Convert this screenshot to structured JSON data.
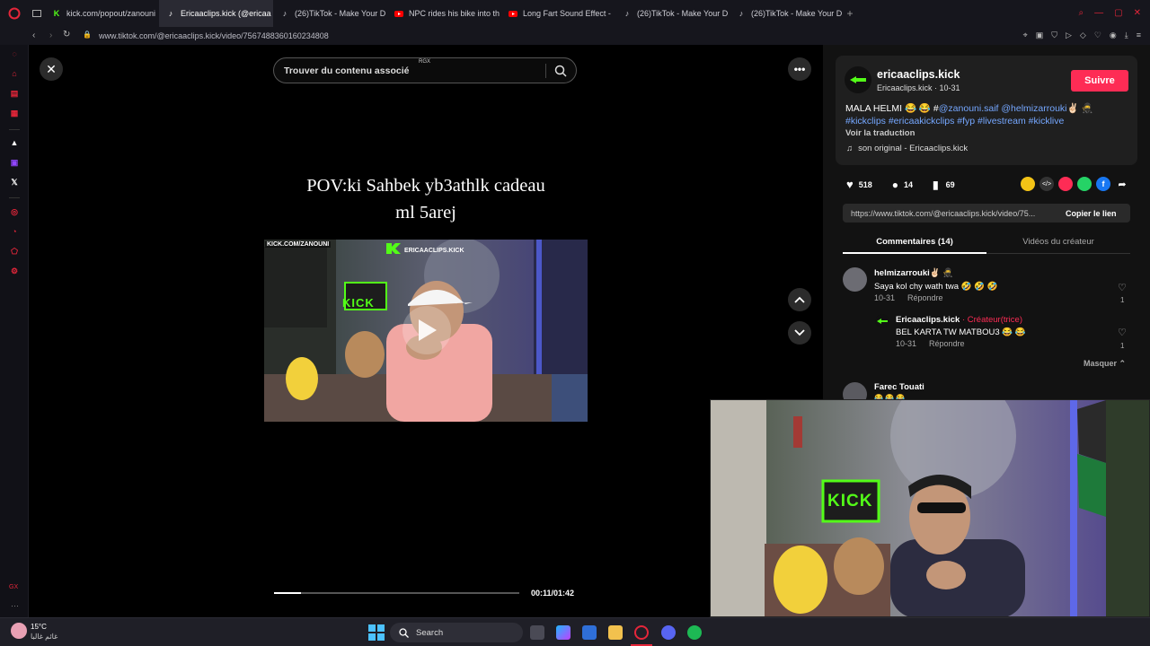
{
  "browser": {
    "tabs": [
      {
        "label": "kick.com/popout/zanouni",
        "icon": "kick-icon",
        "active": false
      },
      {
        "label": "Ericaaclips.kick (@ericaa",
        "icon": "tiktok-icon",
        "active": true
      },
      {
        "label": "(26)TikTok - Make Your D",
        "icon": "tiktok-icon",
        "active": false
      },
      {
        "label": "NPC rides his bike into th",
        "icon": "youtube-icon",
        "active": false
      },
      {
        "label": "Long Fart Sound Effect -",
        "icon": "youtube-icon",
        "active": false
      },
      {
        "label": "(26)TikTok - Make Your D",
        "icon": "tiktok-icon",
        "active": false
      },
      {
        "label": "(26)TikTok - Make Your D",
        "icon": "tiktok-icon",
        "active": false
      }
    ],
    "url": "www.tiktok.com/@ericaaclips.kick/video/7567488360160234808",
    "sidebar_bottom_label": "GX"
  },
  "player": {
    "search_placeholder": "Trouver du contenu associé",
    "search_badge": "RGX",
    "caption_line1": "POV:ki Sahbek yb3athlk cadeau",
    "caption_line2": "ml 5arej",
    "time": "00:11/01:42",
    "progress_fraction": 0.11,
    "stream_overlay_channel": "KICK.COM/ZANOUNI",
    "stream_overlay_watermark": "ERICAACLIPS.KICK",
    "stream_overlay_sign": "KICK"
  },
  "creator": {
    "handle": "ericaaclips.kick",
    "subline": "Ericaaclips.kick · 10-31",
    "follow_label": "Suivre",
    "caption_text": "MALA HELMI 😂 😂 #",
    "caption_mention1": "@zanouni.saif",
    "caption_mention2": "@helmizarrouki",
    "caption_emoji": "✌🏻 🥷",
    "hashtags": "#kickclips #ericaakickclips #fyp #livestream #kicklive",
    "translate_label": "Voir la traduction",
    "sound": "son original - Ericaaclips.kick"
  },
  "stats": {
    "likes": "518",
    "comments": "14",
    "saves": "69"
  },
  "share": {
    "link": "https://www.tiktok.com/@ericaaclips.kick/video/75...",
    "copy_label": "Copier le lien"
  },
  "tabs": {
    "comments": "Commentaires (14)",
    "creator_videos": "Vidéos du créateur"
  },
  "comments": [
    {
      "user": "helmizarrouki✌🏻 🥷",
      "text": "Saya kol chy wath twa 🤣 🤣 🤣",
      "date": "10-31",
      "reply": "Répondre",
      "likes": "1"
    },
    {
      "user": "Ericaaclips.kick",
      "badge": " · Créateur(trice)",
      "text": "BEL KARTA TW MATBOU3 😂 😂",
      "date": "10-31",
      "reply": "Répondre",
      "likes": "1"
    },
    {
      "user": "Farec Touati",
      "text": "😂 😂 😂"
    }
  ],
  "hide_label": "Masquer",
  "taskbar": {
    "temp": "15°C",
    "weather": "غائم غالبا",
    "search_label": "Search"
  },
  "colors": {
    "follow": "#fe2c55",
    "link": "#75a7ff",
    "creator_badge": "#fe2c55",
    "active_tab": "#2a2a33"
  }
}
